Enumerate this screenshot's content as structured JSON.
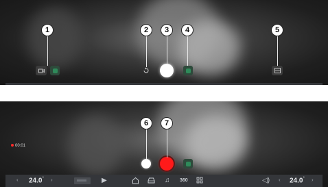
{
  "callouts": {
    "c1": "1",
    "c2": "2",
    "c3": "3",
    "c4": "4",
    "c5": "5",
    "c6": "6",
    "c7": "7"
  },
  "taskbar": {
    "temp_left": "24.0",
    "temp_right": "24.0",
    "degree": "°",
    "arrow_left": "‹",
    "arrow_right": "›",
    "view_360_label": "360"
  },
  "recording": {
    "timer": "00:01"
  },
  "colors": {
    "record_red": "#ff1a1a",
    "green_indicator": "#2f8a5a",
    "taskbar_bg": "#34363a"
  },
  "icons": {
    "camera": "camera-icon",
    "rotate": "rotate-icon",
    "shutter": "shutter-icon",
    "green": "green-indicator-icon",
    "gallery": "gallery-icon",
    "play": "play-icon",
    "home": "home-icon",
    "car": "car-icon",
    "music": "music-icon",
    "view360": "view-360-icon",
    "apps": "apps-icon",
    "volume": "volume-icon"
  }
}
